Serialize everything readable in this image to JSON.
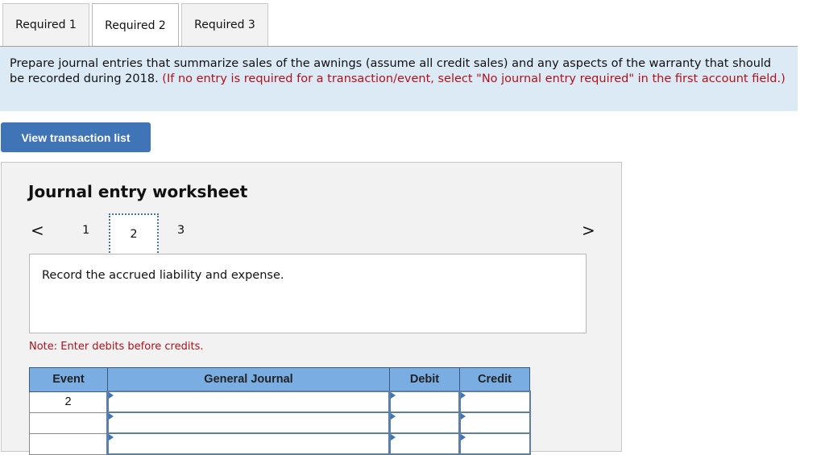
{
  "tabs": [
    {
      "label": "Required 1",
      "active": false
    },
    {
      "label": "Required 2",
      "active": true
    },
    {
      "label": "Required 3",
      "active": false
    }
  ],
  "instructions": {
    "text": "Prepare journal entries that summarize sales of the awnings (assume all credit sales) and any aspects of the warranty that should be recorded during 2018.",
    "note_red": "(If no entry is required for a transaction/event, select \"No journal entry required\" in the first account field.)"
  },
  "view_transactions_button": "View transaction list",
  "worksheet": {
    "title": "Journal entry worksheet",
    "pages": [
      "1",
      "2",
      "3"
    ],
    "current_page": "2",
    "prev_icon": "<",
    "next_icon": ">",
    "description": "Record the accrued liability and expense.",
    "note": "Note: Enter debits before credits.",
    "table": {
      "headers": [
        "Event",
        "General Journal",
        "Debit",
        "Credit"
      ],
      "rows": [
        {
          "event": "2",
          "account": "",
          "debit": "",
          "credit": ""
        },
        {
          "event": "",
          "account": "",
          "debit": "",
          "credit": ""
        },
        {
          "event": "",
          "account": "",
          "debit": "",
          "credit": ""
        }
      ]
    }
  },
  "colors": {
    "accent_blue": "#3f74b6",
    "header_blue": "#7aaee3",
    "info_bg": "#dceaf6",
    "alert_red": "#b0121b"
  }
}
